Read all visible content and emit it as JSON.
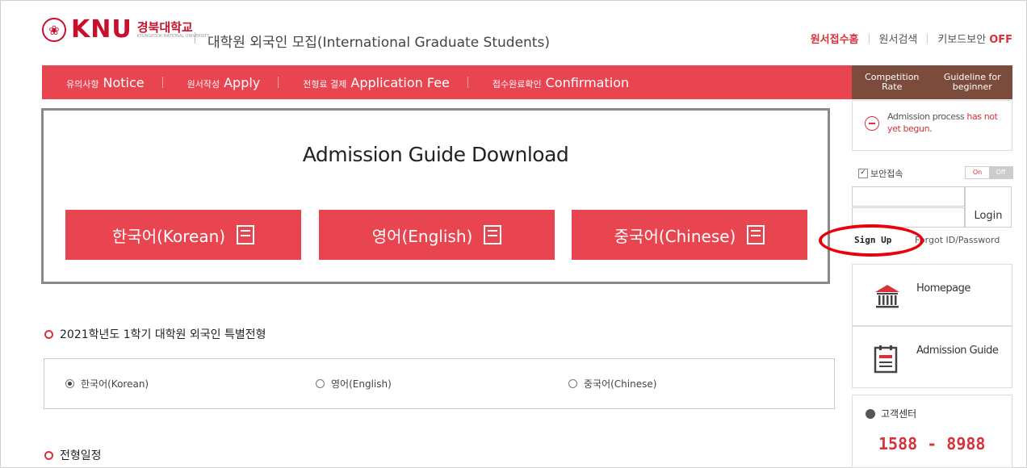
{
  "header": {
    "logo_brand": "KNU",
    "logo_korean": "경북대학교",
    "logo_english": "KYUNGPOOK NATIONAL UNIVERSITY",
    "title": "대학원 외국인 모집(International Graduate Students)",
    "links": {
      "home": "원서접수홈",
      "search": "원서검색",
      "keyboard_security": "키보드보안",
      "keyboard_state": "OFF"
    }
  },
  "nav": {
    "items": [
      {
        "ko": "유의사항",
        "en": "Notice"
      },
      {
        "ko": "원서작성",
        "en": "Apply"
      },
      {
        "ko": "전형료 결제",
        "en": "Application Fee"
      },
      {
        "ko": "접수완료확인",
        "en": "Confirmation"
      }
    ],
    "side": {
      "competition": "Competition Rate",
      "guideline": "Guideline for beginner"
    }
  },
  "guide": {
    "title": "Admission Guide Download",
    "buttons": [
      "한국어(Korean)",
      "영어(English)",
      "중국어(Chinese)"
    ]
  },
  "sections": {
    "program_title": "2021학년도 1학기 대학원 외국인 특별전형",
    "schedule_title": "전형일정",
    "languages": [
      "한국어(Korean)",
      "영어(English)",
      "중국어(Chinese)"
    ],
    "selected_language": "한국어(Korean)"
  },
  "sidebar": {
    "notice_prefix": "Admission process ",
    "notice_highlight": "has not yet begun",
    "notice_suffix": ".",
    "secure_label": "보안접속",
    "toggle_on": "On",
    "toggle_off": "Off",
    "login_label": "Login",
    "signup_label": "Sign Up",
    "forgot_label": "Forgot ID/Password",
    "homepage_label": "Homepage",
    "admission_guide_label": "Admission Guide",
    "customer_center": "고객센터",
    "phone": "1588 - 8988"
  },
  "colors": {
    "accent": "#e84550",
    "side_nav": "#7b4b3c",
    "highlight_circle": "#e8000c"
  }
}
